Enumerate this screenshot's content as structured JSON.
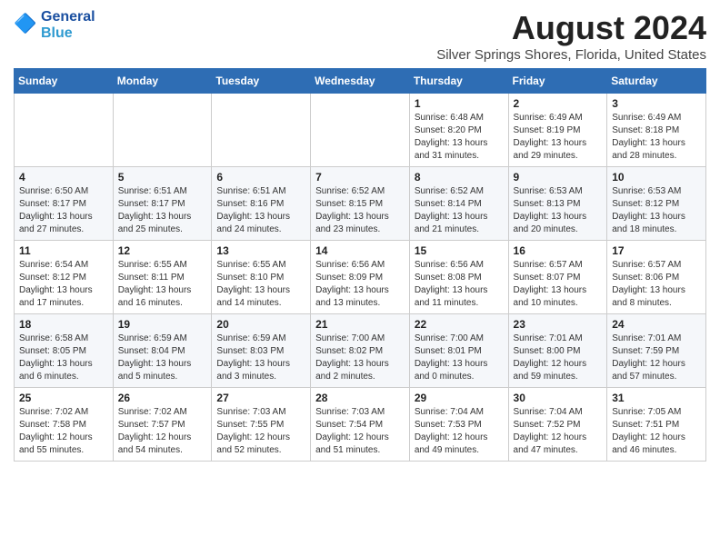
{
  "logo": {
    "line1": "General",
    "line2": "Blue"
  },
  "title": "August 2024",
  "subtitle": "Silver Springs Shores, Florida, United States",
  "weekdays": [
    "Sunday",
    "Monday",
    "Tuesday",
    "Wednesday",
    "Thursday",
    "Friday",
    "Saturday"
  ],
  "weeks": [
    [
      {
        "day": "",
        "info": ""
      },
      {
        "day": "",
        "info": ""
      },
      {
        "day": "",
        "info": ""
      },
      {
        "day": "",
        "info": ""
      },
      {
        "day": "1",
        "info": "Sunrise: 6:48 AM\nSunset: 8:20 PM\nDaylight: 13 hours\nand 31 minutes."
      },
      {
        "day": "2",
        "info": "Sunrise: 6:49 AM\nSunset: 8:19 PM\nDaylight: 13 hours\nand 29 minutes."
      },
      {
        "day": "3",
        "info": "Sunrise: 6:49 AM\nSunset: 8:18 PM\nDaylight: 13 hours\nand 28 minutes."
      }
    ],
    [
      {
        "day": "4",
        "info": "Sunrise: 6:50 AM\nSunset: 8:17 PM\nDaylight: 13 hours\nand 27 minutes."
      },
      {
        "day": "5",
        "info": "Sunrise: 6:51 AM\nSunset: 8:17 PM\nDaylight: 13 hours\nand 25 minutes."
      },
      {
        "day": "6",
        "info": "Sunrise: 6:51 AM\nSunset: 8:16 PM\nDaylight: 13 hours\nand 24 minutes."
      },
      {
        "day": "7",
        "info": "Sunrise: 6:52 AM\nSunset: 8:15 PM\nDaylight: 13 hours\nand 23 minutes."
      },
      {
        "day": "8",
        "info": "Sunrise: 6:52 AM\nSunset: 8:14 PM\nDaylight: 13 hours\nand 21 minutes."
      },
      {
        "day": "9",
        "info": "Sunrise: 6:53 AM\nSunset: 8:13 PM\nDaylight: 13 hours\nand 20 minutes."
      },
      {
        "day": "10",
        "info": "Sunrise: 6:53 AM\nSunset: 8:12 PM\nDaylight: 13 hours\nand 18 minutes."
      }
    ],
    [
      {
        "day": "11",
        "info": "Sunrise: 6:54 AM\nSunset: 8:12 PM\nDaylight: 13 hours\nand 17 minutes."
      },
      {
        "day": "12",
        "info": "Sunrise: 6:55 AM\nSunset: 8:11 PM\nDaylight: 13 hours\nand 16 minutes."
      },
      {
        "day": "13",
        "info": "Sunrise: 6:55 AM\nSunset: 8:10 PM\nDaylight: 13 hours\nand 14 minutes."
      },
      {
        "day": "14",
        "info": "Sunrise: 6:56 AM\nSunset: 8:09 PM\nDaylight: 13 hours\nand 13 minutes."
      },
      {
        "day": "15",
        "info": "Sunrise: 6:56 AM\nSunset: 8:08 PM\nDaylight: 13 hours\nand 11 minutes."
      },
      {
        "day": "16",
        "info": "Sunrise: 6:57 AM\nSunset: 8:07 PM\nDaylight: 13 hours\nand 10 minutes."
      },
      {
        "day": "17",
        "info": "Sunrise: 6:57 AM\nSunset: 8:06 PM\nDaylight: 13 hours\nand 8 minutes."
      }
    ],
    [
      {
        "day": "18",
        "info": "Sunrise: 6:58 AM\nSunset: 8:05 PM\nDaylight: 13 hours\nand 6 minutes."
      },
      {
        "day": "19",
        "info": "Sunrise: 6:59 AM\nSunset: 8:04 PM\nDaylight: 13 hours\nand 5 minutes."
      },
      {
        "day": "20",
        "info": "Sunrise: 6:59 AM\nSunset: 8:03 PM\nDaylight: 13 hours\nand 3 minutes."
      },
      {
        "day": "21",
        "info": "Sunrise: 7:00 AM\nSunset: 8:02 PM\nDaylight: 13 hours\nand 2 minutes."
      },
      {
        "day": "22",
        "info": "Sunrise: 7:00 AM\nSunset: 8:01 PM\nDaylight: 13 hours\nand 0 minutes."
      },
      {
        "day": "23",
        "info": "Sunrise: 7:01 AM\nSunset: 8:00 PM\nDaylight: 12 hours\nand 59 minutes."
      },
      {
        "day": "24",
        "info": "Sunrise: 7:01 AM\nSunset: 7:59 PM\nDaylight: 12 hours\nand 57 minutes."
      }
    ],
    [
      {
        "day": "25",
        "info": "Sunrise: 7:02 AM\nSunset: 7:58 PM\nDaylight: 12 hours\nand 55 minutes."
      },
      {
        "day": "26",
        "info": "Sunrise: 7:02 AM\nSunset: 7:57 PM\nDaylight: 12 hours\nand 54 minutes."
      },
      {
        "day": "27",
        "info": "Sunrise: 7:03 AM\nSunset: 7:55 PM\nDaylight: 12 hours\nand 52 minutes."
      },
      {
        "day": "28",
        "info": "Sunrise: 7:03 AM\nSunset: 7:54 PM\nDaylight: 12 hours\nand 51 minutes."
      },
      {
        "day": "29",
        "info": "Sunrise: 7:04 AM\nSunset: 7:53 PM\nDaylight: 12 hours\nand 49 minutes."
      },
      {
        "day": "30",
        "info": "Sunrise: 7:04 AM\nSunset: 7:52 PM\nDaylight: 12 hours\nand 47 minutes."
      },
      {
        "day": "31",
        "info": "Sunrise: 7:05 AM\nSunset: 7:51 PM\nDaylight: 12 hours\nand 46 minutes."
      }
    ]
  ]
}
